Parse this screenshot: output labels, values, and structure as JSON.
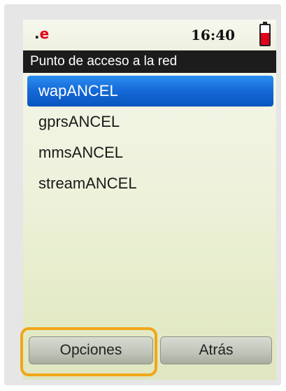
{
  "status_bar": {
    "operator_glyph": ".e",
    "time": "16:40",
    "battery_icon": "battery-icon",
    "battery_level_fraction": 0.6
  },
  "title": "Punto de acceso a la red",
  "access_points": [
    {
      "label": "wapANCEL",
      "selected": true
    },
    {
      "label": "gprsANCEL",
      "selected": false
    },
    {
      "label": "mmsANCEL",
      "selected": false
    },
    {
      "label": "streamANCEL",
      "selected": false
    }
  ],
  "softkeys": {
    "left_label": "Opciones",
    "right_label": "Atrás"
  },
  "colors": {
    "selection": "#1468d6",
    "highlight_ring": "#f0a619",
    "battery_fill": "#e3001b"
  }
}
